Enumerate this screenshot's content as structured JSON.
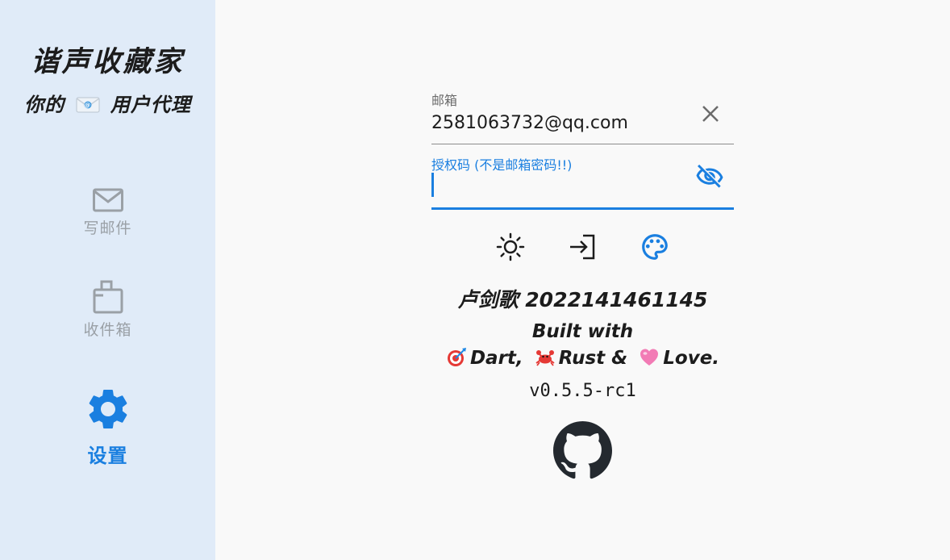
{
  "sidebar": {
    "title": "谐声收藏家",
    "subtitle_before": "你的",
    "subtitle_after": "用户代理",
    "items": [
      {
        "label": "写邮件",
        "icon": "mail-icon",
        "active": false
      },
      {
        "label": "收件箱",
        "icon": "inbox-icon",
        "active": false
      },
      {
        "label": "设置",
        "icon": "gear-icon",
        "active": true
      }
    ]
  },
  "form": {
    "email": {
      "label": "邮箱",
      "value": "2581063732@qq.com"
    },
    "auth_code": {
      "label": "授权码 (不是邮箱密码!!)",
      "value": ""
    }
  },
  "actions": [
    "brightness-icon",
    "login-icon",
    "palette-icon"
  ],
  "about": {
    "author": "卢剑歌 2022141461145",
    "built_with": "Built with",
    "dart": "Dart,",
    "rust": "Rust &",
    "love": "Love.",
    "version": "v0.5.5-rc1"
  },
  "colors": {
    "accent": "#1a7fe0",
    "sidebar_bg": "#e0ebf8",
    "main_bg": "#f9f9f9",
    "inactive": "#9aa0a6",
    "text": "#1c1c1c"
  }
}
